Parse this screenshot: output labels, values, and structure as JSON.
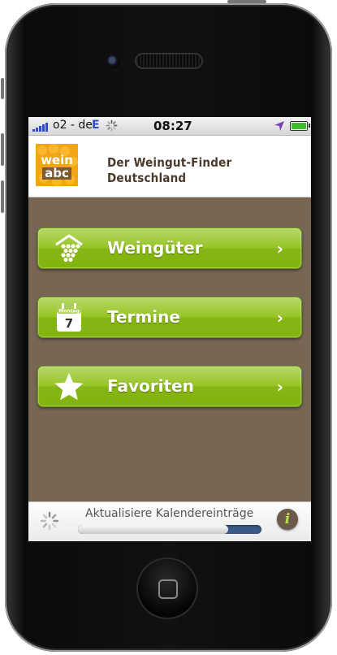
{
  "status_bar": {
    "carrier": "o2 - de",
    "network": "E",
    "time": "08:27",
    "battery_level": 1.0
  },
  "header": {
    "logo_line1": "wein",
    "logo_line2": "abc",
    "title_line1": "Der Weingut-Finder",
    "title_line2": "Deutschland"
  },
  "menu": {
    "items": [
      {
        "label": "Weingüter",
        "icon": "grape-house-icon",
        "chevron": "›"
      },
      {
        "label": "Termine",
        "icon": "calendar-icon",
        "calendar_month": "Montag",
        "calendar_day": "7",
        "chevron": "›"
      },
      {
        "label": "Favoriten",
        "icon": "star-icon",
        "chevron": "›"
      }
    ]
  },
  "bottom_bar": {
    "status_text": "Aktualisiere Kalendereinträge",
    "progress": 0.82,
    "info_label": "i"
  },
  "colors": {
    "background": "#786655",
    "button_green": "#97c526",
    "logo_orange": "#f2a417",
    "title_brown": "#4a3a2c"
  }
}
